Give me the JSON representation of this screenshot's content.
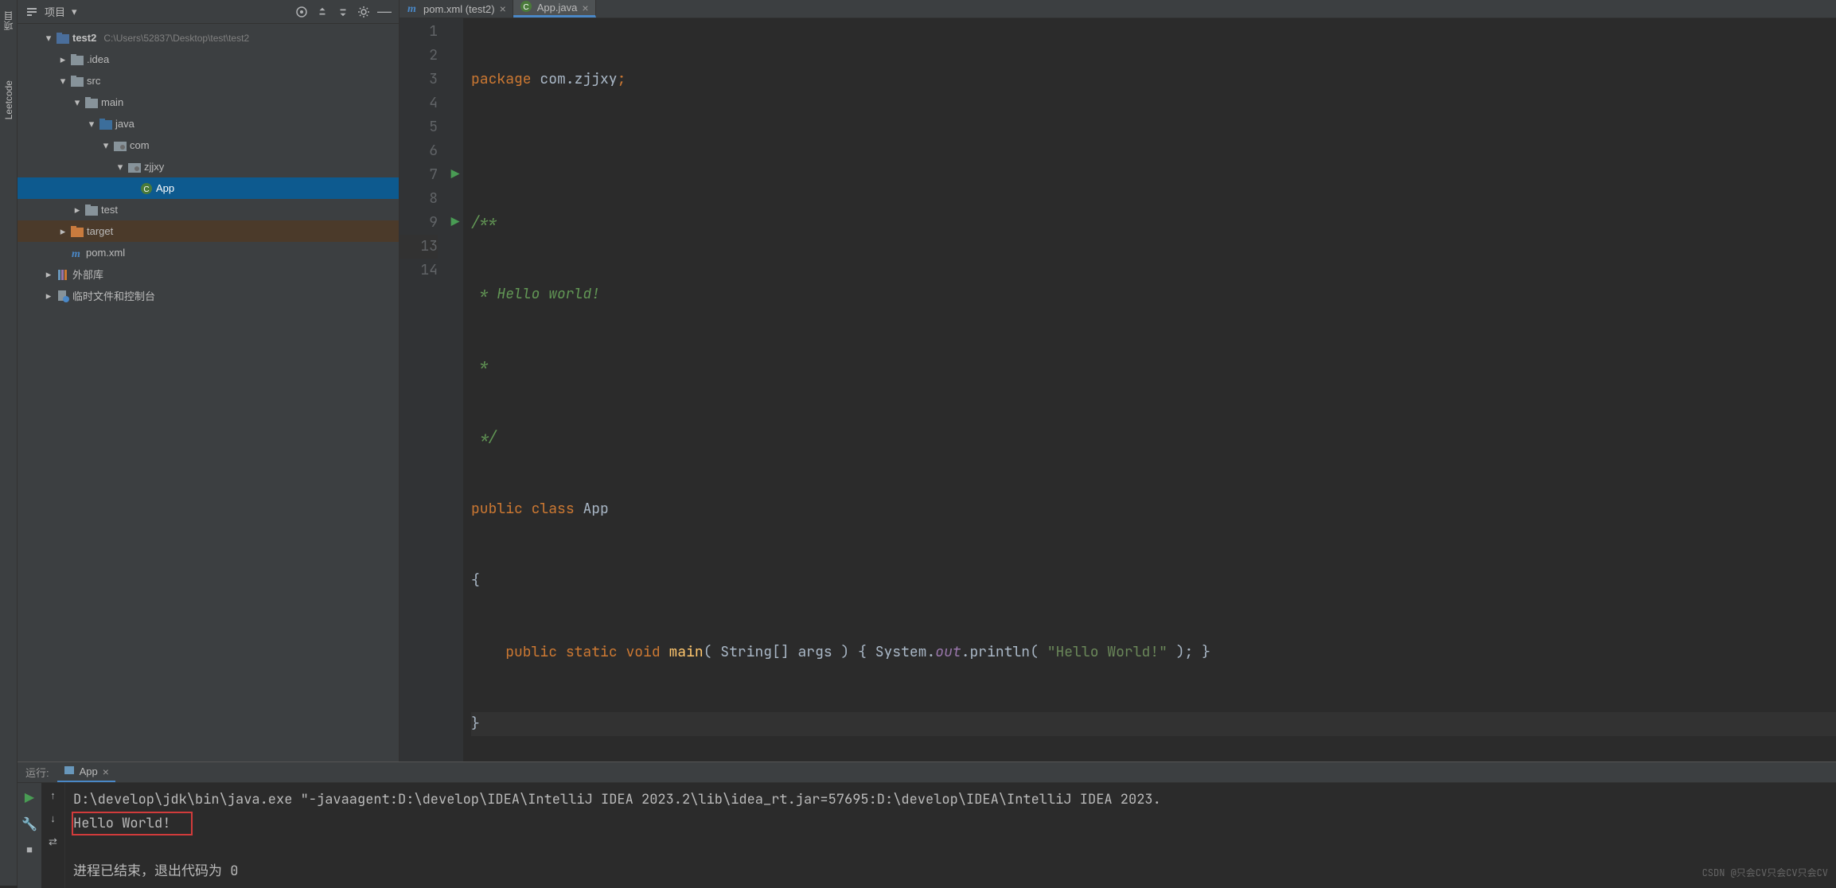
{
  "leftbar": {
    "project_label": "项目",
    "leetcode_label": "Leetcode"
  },
  "toolbar": {
    "dropdown": "项目"
  },
  "tree": {
    "root": {
      "name": "test2",
      "path": "C:\\Users\\52837\\Desktop\\test\\test2"
    },
    "idea": ".idea",
    "src": "src",
    "main": "main",
    "java": "java",
    "com": "com",
    "zjjxy": "zjjxy",
    "app": "App",
    "test": "test",
    "target": "target",
    "pom": "pom.xml",
    "external": "外部库",
    "scratch": "临时文件和控制台"
  },
  "tabs": {
    "pom": "pom.xml (test2)",
    "app": "App.java"
  },
  "editor": {
    "lines": [
      "1",
      "2",
      "3",
      "4",
      "5",
      "6",
      "7",
      "8",
      "9",
      "13",
      "14"
    ],
    "code": {
      "l1_pkg": "package",
      "l1_rest": " com.zjjxy",
      "l1_semi": ";",
      "l3": "/**",
      "l4": " * Hello world!",
      "l5": " *",
      "l6": " */",
      "l7_public": "public",
      "l7_class": "class",
      "l7_name": "App",
      "l8": "{",
      "l9_public": "public",
      "l9_static": "static",
      "l9_void": "void",
      "l9_main": "main",
      "l9_args_open": "( ",
      "l9_args": "String[] args",
      "l9_args_close": " ) { ",
      "l9_sys": "System.",
      "l9_out": "out",
      "l9_println": ".println( ",
      "l9_str": "\"Hello World!\"",
      "l9_end": " ); }",
      "l13": "}"
    }
  },
  "run": {
    "label": "运行:",
    "tab": "App",
    "cmd": "D:\\develop\\jdk\\bin\\java.exe \"-javaagent:D:\\develop\\IDEA\\IntelliJ IDEA 2023.2\\lib\\idea_rt.jar=57695:D:\\develop\\IDEA\\IntelliJ IDEA 2023.",
    "output": "Hello World!",
    "exit": "进程已结束，退出代码为 0"
  },
  "watermark": "CSDN @只会CV只会CV只会CV"
}
